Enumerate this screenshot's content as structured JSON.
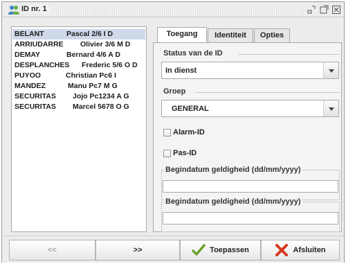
{
  "window": {
    "title": "ID nr. 1",
    "icons": [
      "users-icon",
      "minimize-icon",
      "maximize-icon",
      "close-icon"
    ]
  },
  "list": {
    "items": [
      {
        "name": "BELANT",
        "detail": "Pascal 2/6 I D",
        "selected": true
      },
      {
        "name": "ARRIUDARRE",
        "detail": "Olivier 3/6 M D"
      },
      {
        "name": "DEMAY",
        "detail": "Bernard 4/6 A D"
      },
      {
        "name": "DESPLANCHES",
        "detail": "Frederic 5/6 O D"
      },
      {
        "name": "PUYOO",
        "detail": "Christian Pc6 I"
      },
      {
        "name": "MANDEZ",
        "detail": "Manu Pc7 M G"
      },
      {
        "name": "SECURITAS",
        "detail": "Jojo Pc1234 A G"
      },
      {
        "name": "SECURITAS",
        "detail": "Marcel 5678 O G"
      }
    ]
  },
  "tabs": [
    {
      "label": "Toegang",
      "active": true
    },
    {
      "label": "Identiteit"
    },
    {
      "label": "Opties"
    }
  ],
  "form": {
    "status_label": "Status van de ID",
    "status_value": "In dienst",
    "group_label": "Groep",
    "group_value": "GENERAL",
    "alarm_label": "Alarm-ID",
    "alarm_checked": false,
    "pas_label": "Pas-ID",
    "pas_checked": false,
    "date1_label": "Begindatum geldigheid (dd/mm/yyyy)",
    "date1_value": "",
    "date2_label": "Begindatum geldigheid (dd/mm/yyyy)",
    "date2_value": ""
  },
  "buttons": {
    "prev": "<<",
    "next": ">>",
    "apply": "Toepassen",
    "close": "Afsluiten"
  },
  "colors": {
    "selection": "#cfd9ea",
    "apply_check": "#6aa22b",
    "close_x": "#d8381e"
  }
}
